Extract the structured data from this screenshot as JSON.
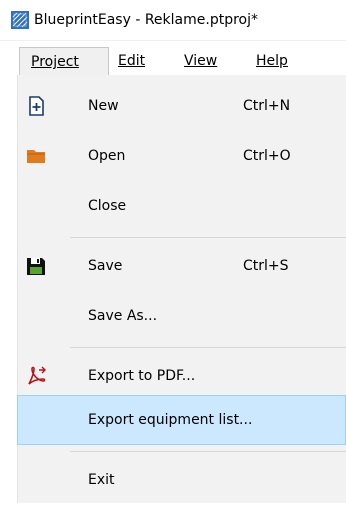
{
  "window": {
    "title": "BlueprintEasy - Reklame.ptproj*"
  },
  "menubar": {
    "items": [
      "Project",
      "Edit",
      "View",
      "Help"
    ]
  },
  "menu": {
    "new": {
      "label": "New",
      "shortcut": "Ctrl+N"
    },
    "open": {
      "label": "Open",
      "shortcut": "Ctrl+O"
    },
    "close": {
      "label": "Close"
    },
    "save": {
      "label": "Save",
      "shortcut": "Ctrl+S"
    },
    "save_as": {
      "label": "Save As..."
    },
    "export_pdf": {
      "label": "Export to PDF..."
    },
    "export_equipment": {
      "label": "Export equipment list..."
    },
    "exit": {
      "label": "Exit"
    }
  },
  "colors": {
    "highlight": "#cce8ff",
    "highlight_border": "#99d1ff",
    "menu_bg": "#f2f2f2",
    "folder_icon": "#e07b1e",
    "pdf_icon": "#b3161a",
    "app_icon": "#2f6fbf"
  },
  "icons": {
    "app": "blueprint-app-icon",
    "new": "new-document-icon",
    "open": "folder-icon",
    "save": "floppy-save-icon",
    "export_pdf": "pdf-icon"
  }
}
